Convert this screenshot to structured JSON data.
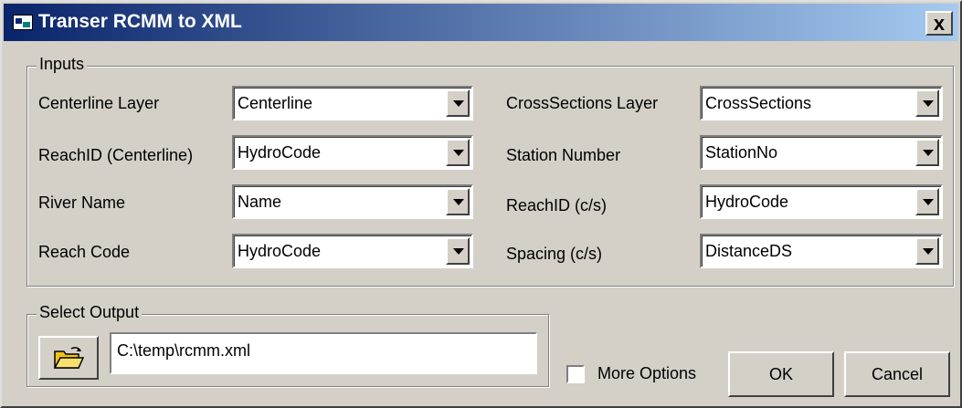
{
  "window": {
    "title": "Transer RCMM to XML",
    "close_label": "x"
  },
  "inputs": {
    "legend": "Inputs",
    "left": [
      {
        "label": "Centerline Layer",
        "value": "Centerline"
      },
      {
        "label": "ReachID (Centerline)",
        "value": "HydroCode"
      },
      {
        "label": "River Name",
        "value": "Name"
      },
      {
        "label": "Reach Code",
        "value": "HydroCode"
      }
    ],
    "right": [
      {
        "label": "CrossSections Layer",
        "value": "CrossSections"
      },
      {
        "label": "Station Number",
        "value": "StationNo"
      },
      {
        "label": "ReachID (c/s)",
        "value": "HydroCode"
      },
      {
        "label": "Spacing (c/s)",
        "value": "DistanceDS"
      }
    ]
  },
  "output": {
    "legend": "Select Output",
    "path": "C:\\temp\\rcmm.xml"
  },
  "options": {
    "more_options_label": "More Options",
    "more_options_checked": false
  },
  "buttons": {
    "ok": "OK",
    "cancel": "Cancel"
  },
  "icons": {
    "browse": "folder-open-icon",
    "app": "app-window-icon"
  }
}
